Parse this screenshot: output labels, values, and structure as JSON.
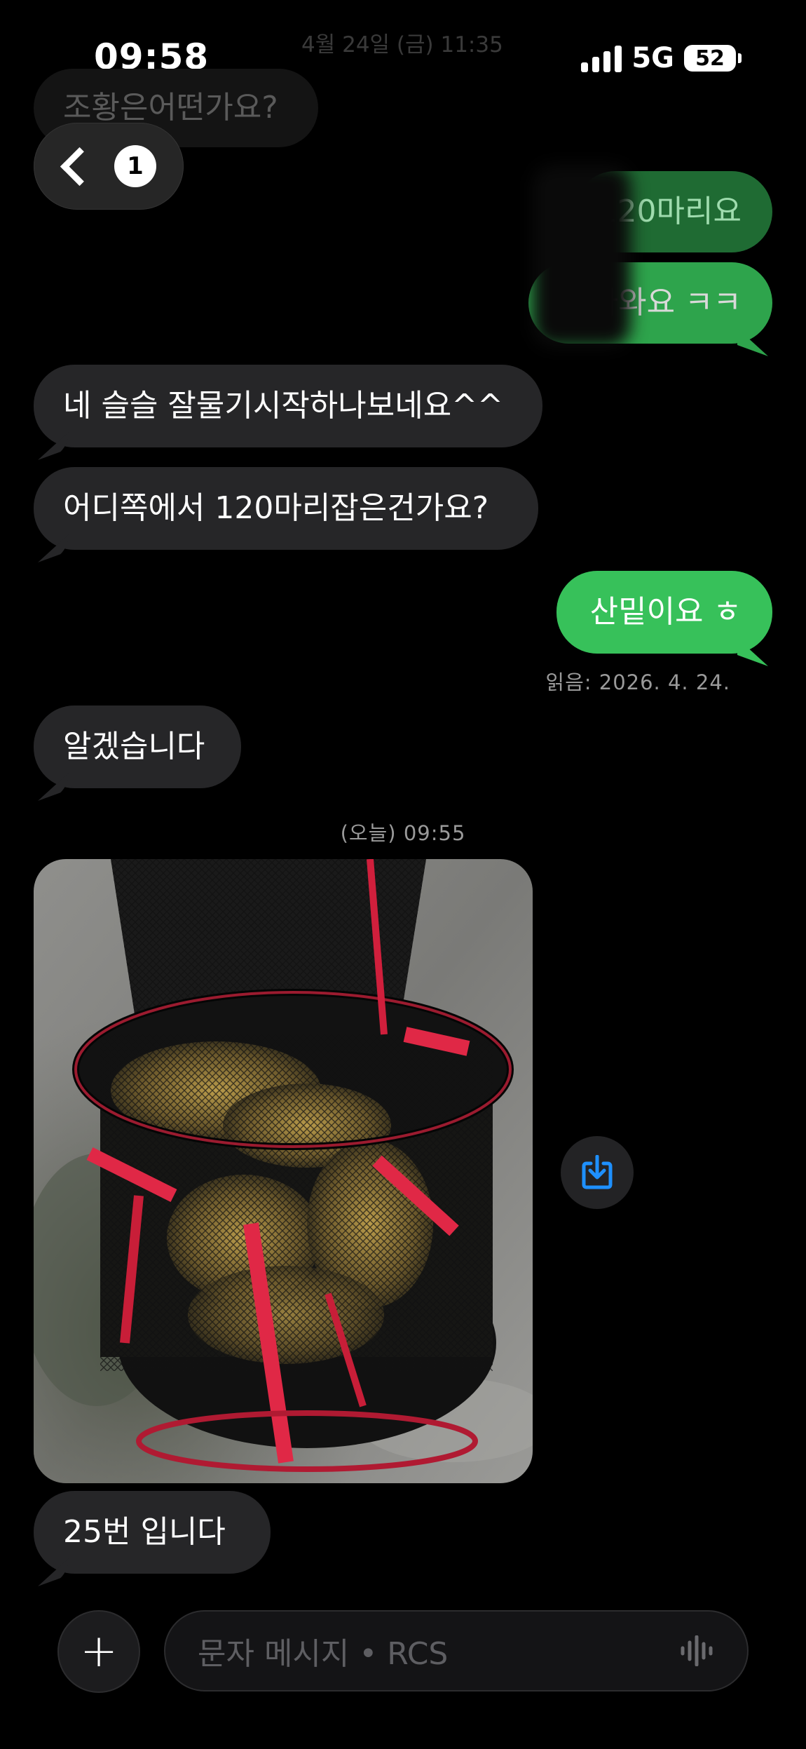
{
  "status": {
    "time": "09:58",
    "network": "5G",
    "battery": "52",
    "faded_date": "4월 24일 (금) 11:35"
  },
  "header": {
    "back_count": "1"
  },
  "messages": {
    "ghost_in": "조황은어떤가요?",
    "ghost_out_1": "120마리요",
    "ghost_out_2": "잡아와요 ㅋㅋ",
    "in_1": "네 슬슬 잘물기시작하나보네요^^",
    "in_2": "어디쪽에서 120마리잡은건가요?",
    "out_1": "산밑이요 ㅎ",
    "read_receipt": "읽음: 2026. 4. 24.",
    "in_3": "알겠습니다",
    "timestamp": "(오늘) 09:55",
    "in_4": "25번  입니다"
  },
  "composer": {
    "placeholder": "문자 메시지 • RCS"
  },
  "icons": [
    "chevron-left-icon",
    "download-icon",
    "plus-icon",
    "voice-waveform-icon"
  ],
  "colors": {
    "outgoing": "#37c15a",
    "incoming": "#262628",
    "accent_blue": "#1e90ff"
  }
}
